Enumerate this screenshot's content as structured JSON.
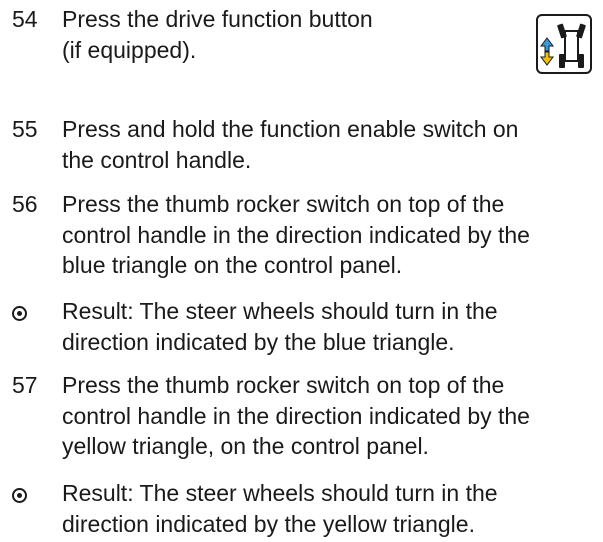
{
  "steps": [
    {
      "num": "54",
      "lines": [
        "Press the drive function button",
        "(if equipped)."
      ]
    },
    {
      "num": "55",
      "lines": [
        "Press and hold the function enable switch on",
        "the control handle."
      ]
    },
    {
      "num": "56",
      "lines": [
        "Press the thumb rocker switch on top of the",
        "control handle in the direction indicated by the",
        "blue triangle on the control panel."
      ]
    },
    {
      "num": "",
      "lines": [
        "Result: The steer wheels should turn in the",
        "direction indicated by the blue triangle."
      ]
    },
    {
      "num": "57",
      "lines": [
        "Press the thumb rocker switch on top of the",
        "control handle in the direction indicated by the",
        "yellow triangle, on the control panel."
      ]
    },
    {
      "num": "",
      "lines": [
        "Result: The steer wheels should turn in the",
        "direction indicated by the yellow triangle."
      ]
    }
  ],
  "icon": {
    "name": "drive-function-icon",
    "colors": {
      "up_arrow": "#3a9ad9",
      "down_arrow": "#f2c200"
    }
  }
}
